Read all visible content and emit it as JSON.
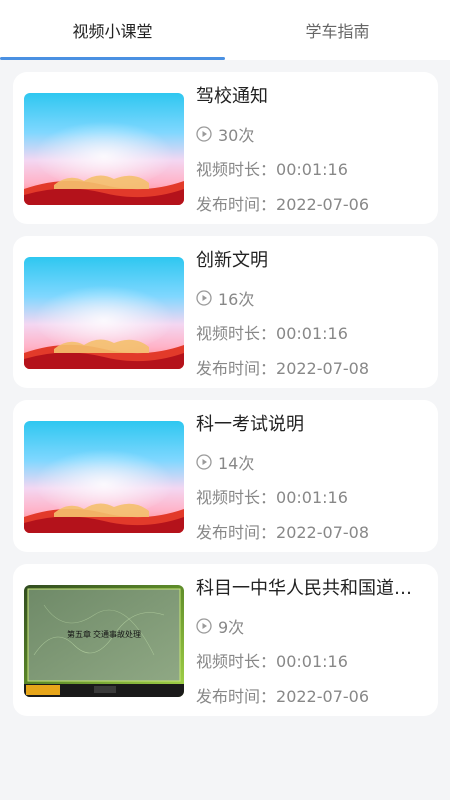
{
  "tabs": [
    {
      "label": "视频小课堂"
    },
    {
      "label": "学车指南"
    }
  ],
  "videos": [
    {
      "title": "驾校通知",
      "views": "30次",
      "duration_label": "视频时长：",
      "duration": "00:01:16",
      "date_label": "发布时间：",
      "date": "2022-07-06"
    },
    {
      "title": "创新文明",
      "views": "16次",
      "duration_label": "视频时长：",
      "duration": "00:01:16",
      "date_label": "发布时间：",
      "date": "2022-07-08"
    },
    {
      "title": "科一考试说明",
      "views": "14次",
      "duration_label": "视频时长：",
      "duration": "00:01:16",
      "date_label": "发布时间：",
      "date": "2022-07-08"
    },
    {
      "title": "科目一中华人民共和国道路交通安全法",
      "views": "9次",
      "duration_label": "视频时长：",
      "duration": "00:01:16",
      "date_label": "发布时间：",
      "date": "2022-07-06",
      "thumb_caption": "第五章 交通事故处理"
    }
  ],
  "colors": {
    "accent": "#4a90e2",
    "background": "#f4f5f7"
  }
}
